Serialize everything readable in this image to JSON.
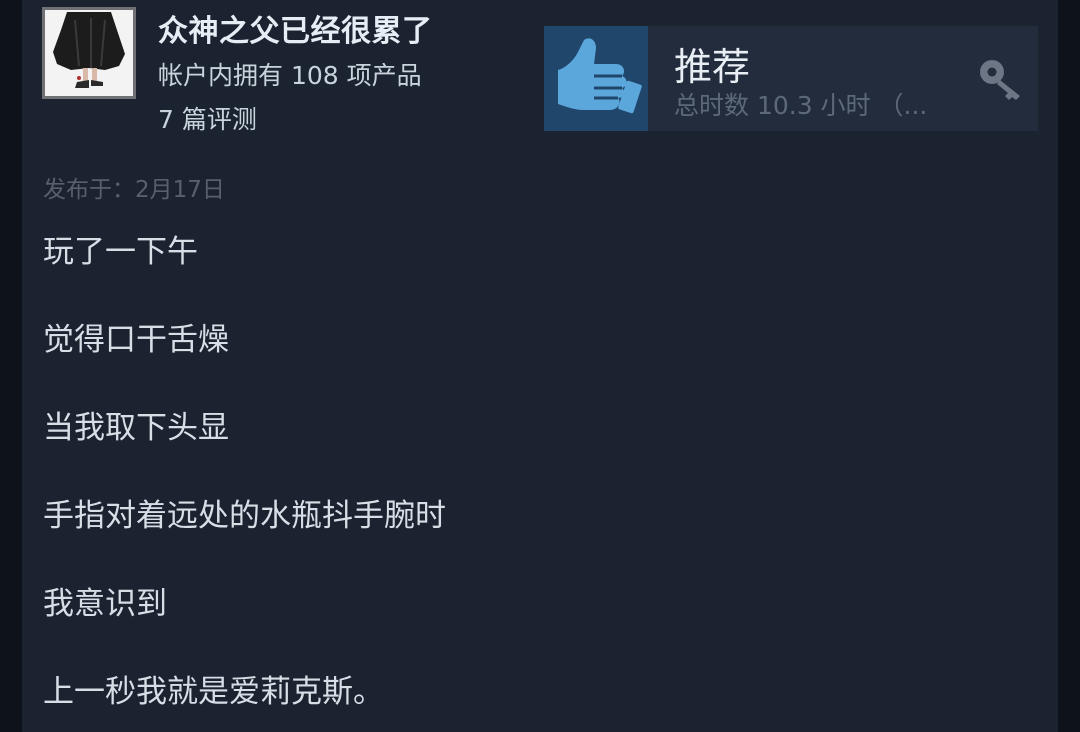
{
  "author": {
    "name": "众神之父已经很累了",
    "products_owned": "帐户内拥有 108 项产品",
    "review_count": "7 篇评测",
    "avatar_icon": "user-avatar-icon"
  },
  "recommendation": {
    "label": "推荐",
    "hours": "总时数 10.3 小时 （...",
    "thumb_icon": "thumbs-up-icon",
    "key_icon": "key-icon",
    "thumb_color": "#5ba7dc"
  },
  "post": {
    "date": "发布于：2月17日",
    "lines": [
      "玩了一下午",
      "觉得口干舌燥",
      "当我取下头显",
      "手指对着远处的水瓶抖手腕时",
      "我意识到",
      "上一秒我就是爱莉克斯。"
    ]
  }
}
